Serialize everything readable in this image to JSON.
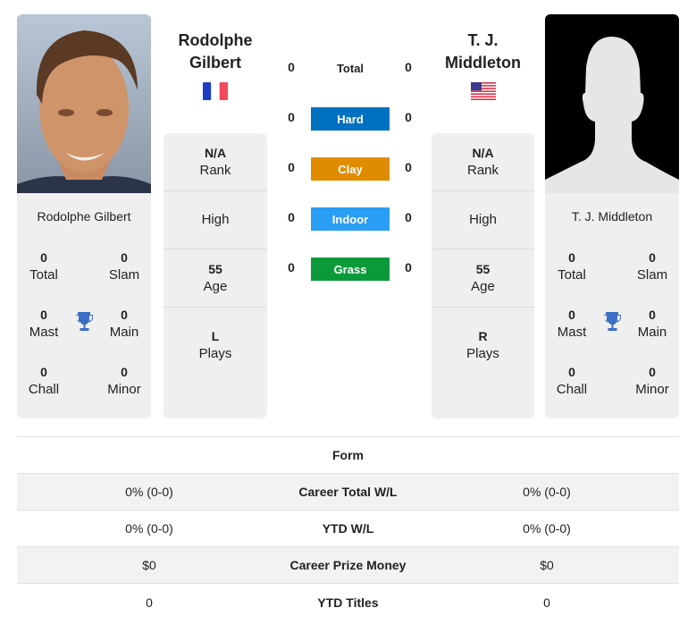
{
  "player1": {
    "name": "Rodolphe Gilbert",
    "name_line1": "Rodolphe",
    "name_line2": "Gilbert",
    "flag": "france-flag",
    "photo": "player-photo",
    "rank_value": "N/A",
    "rank_label": "Rank",
    "high_label": "High",
    "age_value": "55",
    "age_label": "Age",
    "plays_value": "L",
    "plays_label": "Plays",
    "titles": {
      "total": {
        "value": "0",
        "label": "Total"
      },
      "slam": {
        "value": "0",
        "label": "Slam"
      },
      "mast": {
        "value": "0",
        "label": "Mast"
      },
      "main": {
        "value": "0",
        "label": "Main"
      },
      "chall": {
        "value": "0",
        "label": "Chall"
      },
      "minor": {
        "value": "0",
        "label": "Minor"
      }
    }
  },
  "player2": {
    "name": "T. J. Middleton",
    "name_line1": "T. J.",
    "name_line2": "Middleton",
    "flag": "usa-flag",
    "photo": "silhouette-placeholder",
    "rank_value": "N/A",
    "rank_label": "Rank",
    "high_label": "High",
    "age_value": "55",
    "age_label": "Age",
    "plays_value": "R",
    "plays_label": "Plays",
    "titles": {
      "total": {
        "value": "0",
        "label": "Total"
      },
      "slam": {
        "value": "0",
        "label": "Slam"
      },
      "mast": {
        "value": "0",
        "label": "Mast"
      },
      "main": {
        "value": "0",
        "label": "Main"
      },
      "chall": {
        "value": "0",
        "label": "Chall"
      },
      "minor": {
        "value": "0",
        "label": "Minor"
      }
    }
  },
  "h2h": {
    "total": {
      "label": "Total",
      "p1": "0",
      "p2": "0"
    },
    "surfaces": [
      {
        "label": "Hard",
        "p1": "0",
        "p2": "0",
        "color": "#0070c0"
      },
      {
        "label": "Clay",
        "p1": "0",
        "p2": "0",
        "color": "#e08c00"
      },
      {
        "label": "Indoor",
        "p1": "0",
        "p2": "0",
        "color": "#2a9df4"
      },
      {
        "label": "Grass",
        "p1": "0",
        "p2": "0",
        "color": "#0a9a3a"
      }
    ]
  },
  "form_table": {
    "header": "Form",
    "rows": [
      {
        "label": "Career Total W/L",
        "p1": "0% (0-0)",
        "p2": "0% (0-0)"
      },
      {
        "label": "YTD W/L",
        "p1": "0% (0-0)",
        "p2": "0% (0-0)"
      },
      {
        "label": "Career Prize Money",
        "p1": "$0",
        "p2": "$0"
      },
      {
        "label": "YTD Titles",
        "p1": "0",
        "p2": "0"
      }
    ]
  },
  "colors": {
    "trophy": "#3a6fc4",
    "card_bg": "#efefef"
  }
}
